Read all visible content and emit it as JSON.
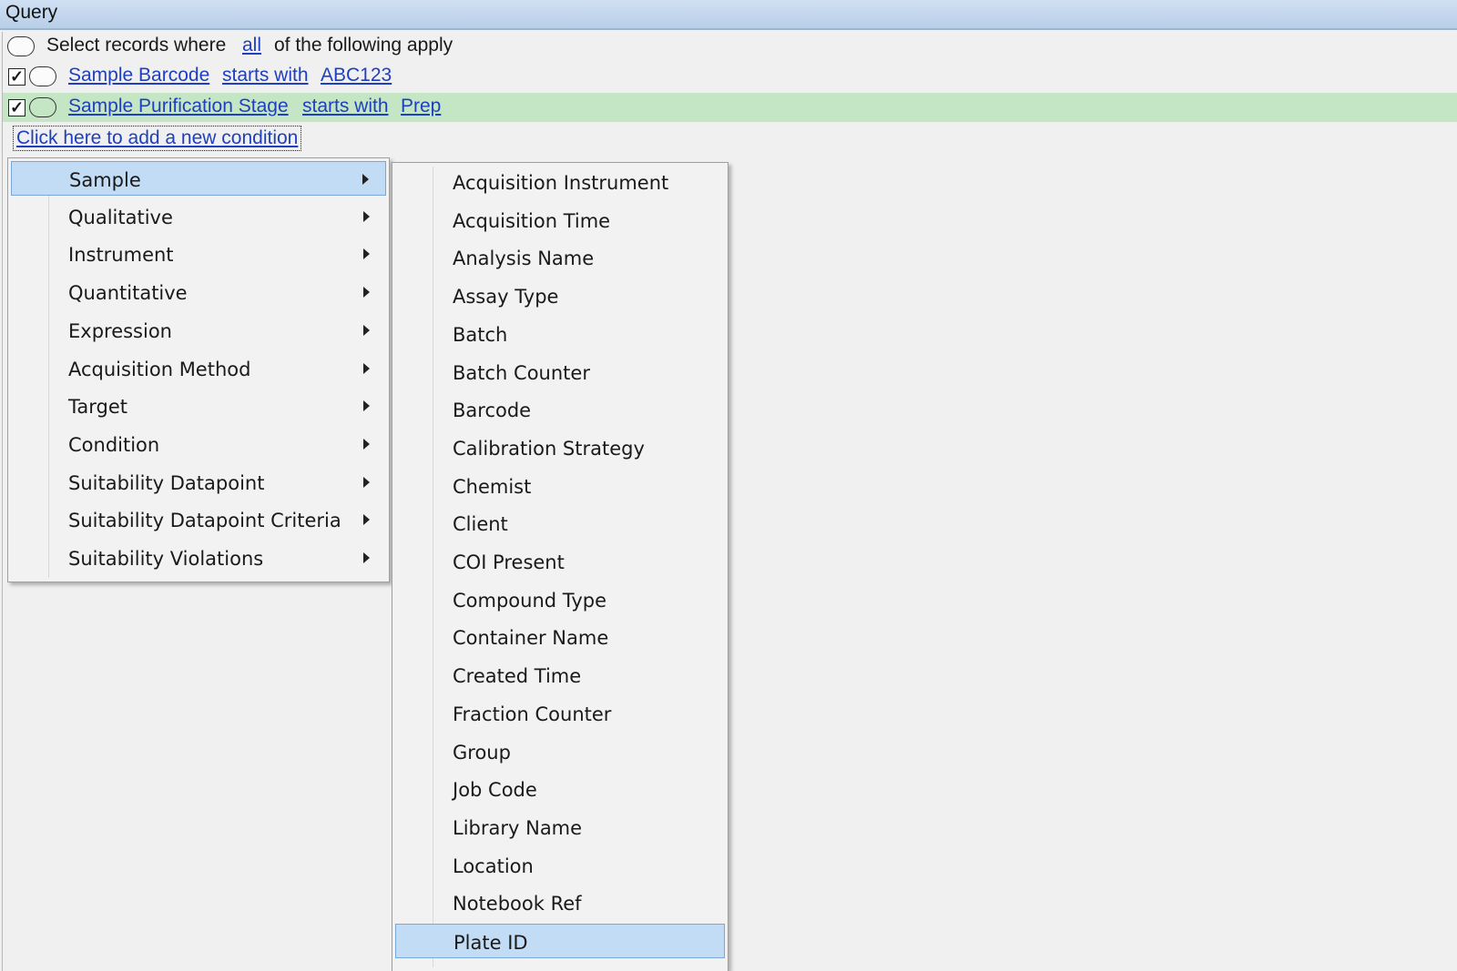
{
  "window": {
    "title": "Query"
  },
  "query": {
    "header": {
      "prefix": "Select records where",
      "mode": "all",
      "suffix": "of the following apply"
    },
    "conditions": [
      {
        "field": "Sample Barcode",
        "operator": "starts with",
        "value": "ABC123",
        "checked": true
      },
      {
        "field": "Sample Purification Stage",
        "operator": "starts with",
        "value": "Prep",
        "checked": true,
        "highlighted": true
      }
    ],
    "add_condition": "Click here to add a new condition"
  },
  "context_menu": {
    "selected": "Sample",
    "items": [
      "Sample",
      "Qualitative",
      "Instrument",
      "Quantitative",
      "Expression",
      "Acquisition Method",
      "Target",
      "Condition",
      "Suitability Datapoint",
      "Suitability Datapoint Criteria",
      "Suitability Violations"
    ]
  },
  "submenu": {
    "selected": "Plate ID",
    "items": [
      "Acquisition Instrument",
      "Acquisition Time",
      "Analysis Name",
      "Assay Type",
      "Batch",
      "Batch Counter",
      "Barcode",
      "Calibration Strategy",
      "Chemist",
      "Client",
      "COI Present",
      "Compound Type",
      "Container Name",
      "Created Time",
      "Fraction Counter",
      "Group",
      "Job Code",
      "Library Name",
      "Location",
      "Notebook Ref",
      "Plate ID"
    ]
  },
  "colors": {
    "link": "#1f3fbf",
    "row_highlight": "#c5e6c5",
    "menu_selection": "#c2dcf5"
  }
}
